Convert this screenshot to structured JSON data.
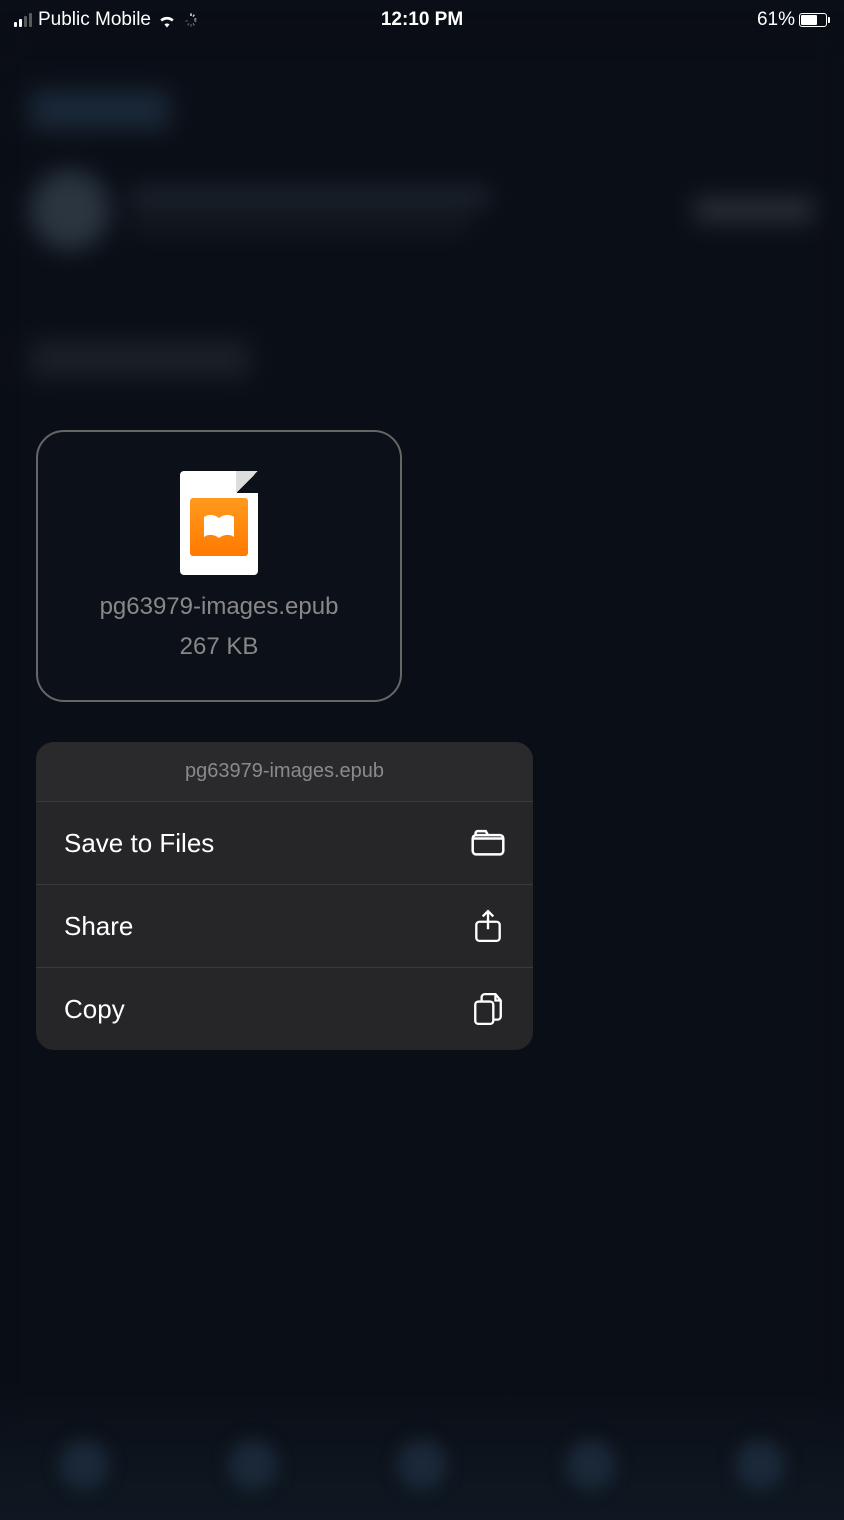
{
  "status_bar": {
    "carrier": "Public Mobile",
    "time": "12:10 PM",
    "battery_percent": "61%"
  },
  "attachment": {
    "file_name": "pg63979-images.epub",
    "file_size": "267 KB"
  },
  "context_menu": {
    "header": "pg63979-images.epub",
    "items": {
      "save_to_files": "Save to Files",
      "share": "Share",
      "copy": "Copy"
    }
  }
}
